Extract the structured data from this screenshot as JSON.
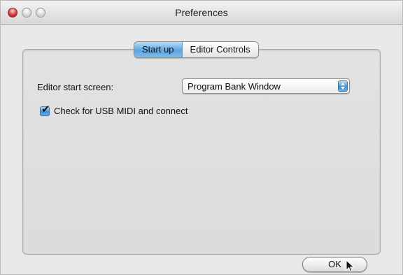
{
  "window": {
    "title": "Preferences"
  },
  "tabs": [
    {
      "label": "Start up",
      "active": true
    },
    {
      "label": "Editor Controls",
      "active": false
    }
  ],
  "startup": {
    "start_screen_label": "Editor start screen:",
    "start_screen_value": "Program Bank Window",
    "usb_check_label": "Check for USB MIDI and connect",
    "usb_checked": true
  },
  "footer": {
    "ok_label": "OK"
  },
  "colors": {
    "accent": "#5aa6e3",
    "window_bg": "#e9e9e9"
  },
  "icons": {
    "close": "close-icon",
    "minimize": "minimize-icon",
    "zoom": "zoom-icon",
    "popup": "popup-arrow-icon",
    "check": "checkmark-icon",
    "cursor": "mouse-pointer-icon"
  }
}
